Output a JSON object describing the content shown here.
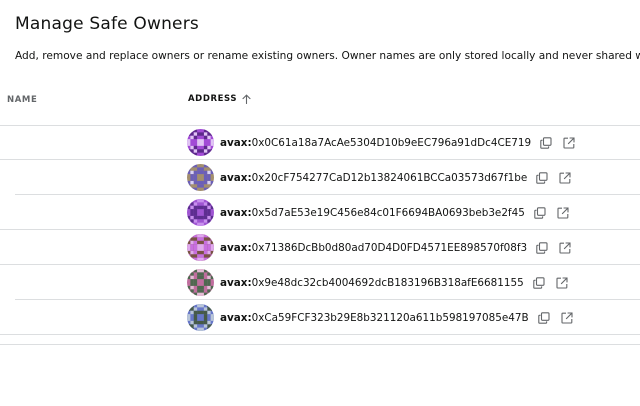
{
  "page": {
    "title": "Manage Safe Owners",
    "subtitle": "Add, remove and replace owners or rename existing owners. Owner names are only stored locally and never shared w"
  },
  "table": {
    "columns": {
      "name": "NAME",
      "address": "ADDRESS"
    },
    "sort": {
      "column": "address",
      "direction": "ascending",
      "icon": "arrow-up-icon"
    },
    "owners": [
      {
        "prefix": "avax:",
        "address": "0x0C61a18a7AcAe5304D10b9eEC796a91dDc4CE719",
        "avatar": {
          "bg": "#a24bd6",
          "fg": "#5c2a8a",
          "accent": "#e0c4f4"
        }
      },
      {
        "prefix": "avax:",
        "address": "0x20cF754277CaD12b13824061BCCa03573d67f1be",
        "avatar": {
          "bg": "#a38f6e",
          "fg": "#6b5fb8",
          "accent": "#d8d1f6"
        }
      },
      {
        "prefix": "avax:",
        "address": "0x5d7aE53e19C456e84c01F6694BA0693beb3e2f45",
        "avatar": {
          "bg": "#9f55d2",
          "fg": "#5d2e90",
          "accent": "#c890ee"
        }
      },
      {
        "prefix": "avax:",
        "address": "0x71386DcBb0d80ad70D4D0FD4571EE898570f08f3",
        "avatar": {
          "bg": "#7a5245",
          "fg": "#c86fe0",
          "accent": "#e0a9ee"
        }
      },
      {
        "prefix": "avax:",
        "address": "0x9e48dc32cb4004692dcB183196B318afE6681155",
        "avatar": {
          "bg": "#c06e9e",
          "fg": "#4f6950",
          "accent": "#e4bcd6"
        }
      },
      {
        "prefix": "avax:",
        "address": "0xCa59FCF323b29E8b321120a611b598197085e47B",
        "avatar": {
          "bg": "#6777c8",
          "fg": "#465a48",
          "accent": "#b9c6d8"
        }
      }
    ],
    "row_icons": [
      "copy-icon",
      "external-link-icon"
    ]
  }
}
